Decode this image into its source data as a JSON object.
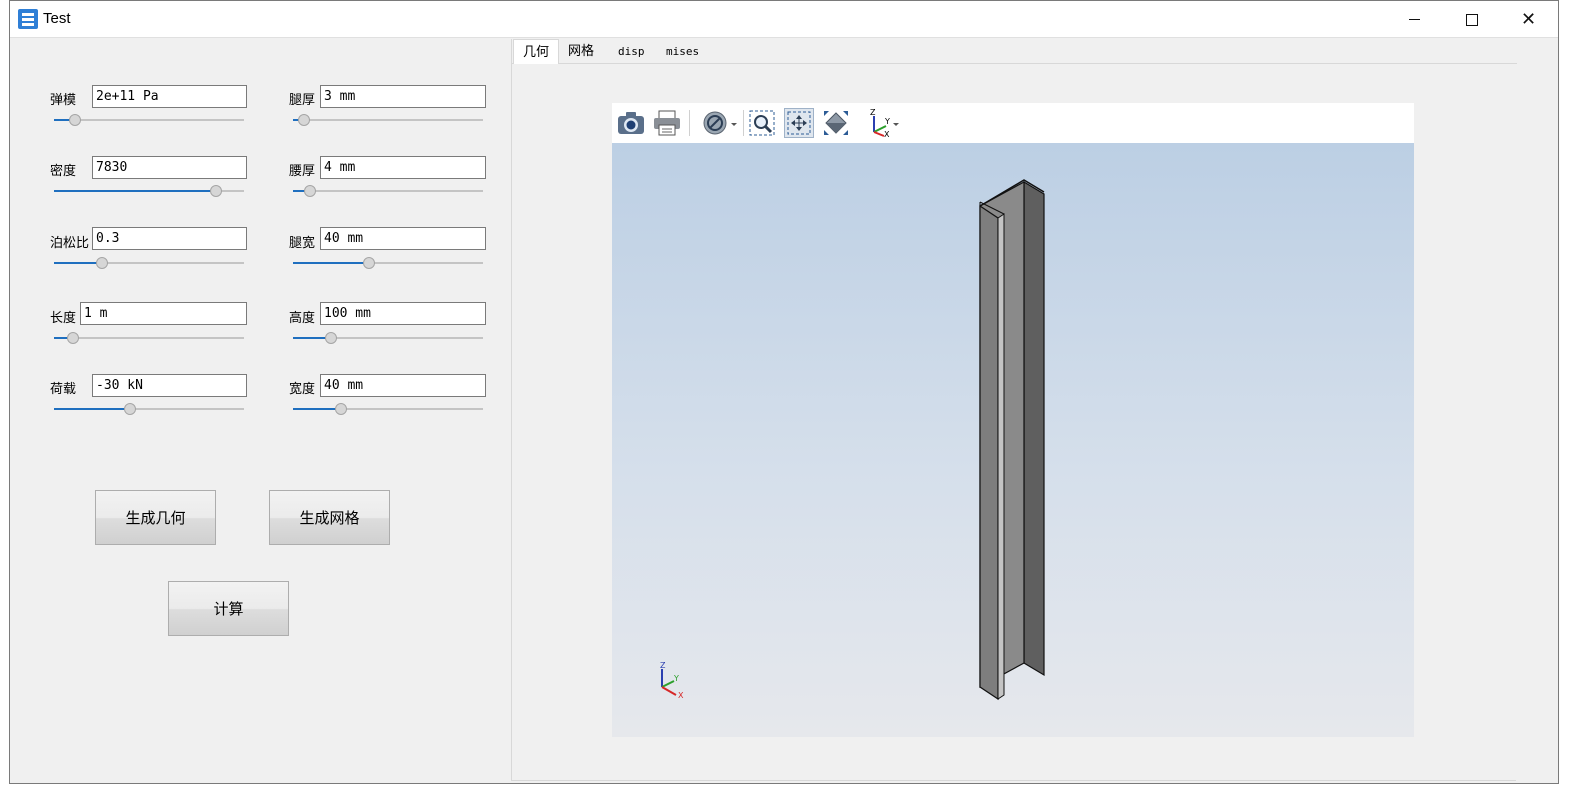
{
  "window": {
    "title": "Test"
  },
  "params": {
    "left": [
      {
        "label": "弹模",
        "value": "2e+11 Pa",
        "slider": 0.11
      },
      {
        "label": "密度",
        "value": "7830",
        "slider": 0.85
      },
      {
        "label": "泊松比",
        "value": "0.3",
        "slider": 0.25
      },
      {
        "label": "长度",
        "value": "1 m",
        "slider": 0.1
      },
      {
        "label": "荷载",
        "value": "-30 kN",
        "slider": 0.4
      }
    ],
    "right": [
      {
        "label": "腿厚",
        "value": "3 mm",
        "slider": 0.06
      },
      {
        "label": "腰厚",
        "value": "4 mm",
        "slider": 0.09
      },
      {
        "label": "腿宽",
        "value": "40 mm",
        "slider": 0.4
      },
      {
        "label": "高度",
        "value": "100 mm",
        "slider": 0.2
      },
      {
        "label": "宽度",
        "value": "40 mm",
        "slider": 0.25
      }
    ]
  },
  "buttons": {
    "gen_geometry": "生成几何",
    "gen_mesh": "生成网格",
    "compute": "计算"
  },
  "tabs": [
    "几何",
    "网格",
    "disp",
    "mises"
  ],
  "active_tab": 0,
  "toolbar_icons": [
    "camera-icon",
    "print-icon",
    "view-style-icon",
    "zoom-window-icon",
    "pan-icon",
    "fit-all-icon",
    "axes-orientation-icon"
  ],
  "triad": {
    "x": "X",
    "y": "Y",
    "z": "Z"
  },
  "colors": {
    "accent": "#1f6fbf",
    "scene_top": "#bccfe4",
    "scene_bottom": "#e6e8ec",
    "beam": "#808080"
  }
}
